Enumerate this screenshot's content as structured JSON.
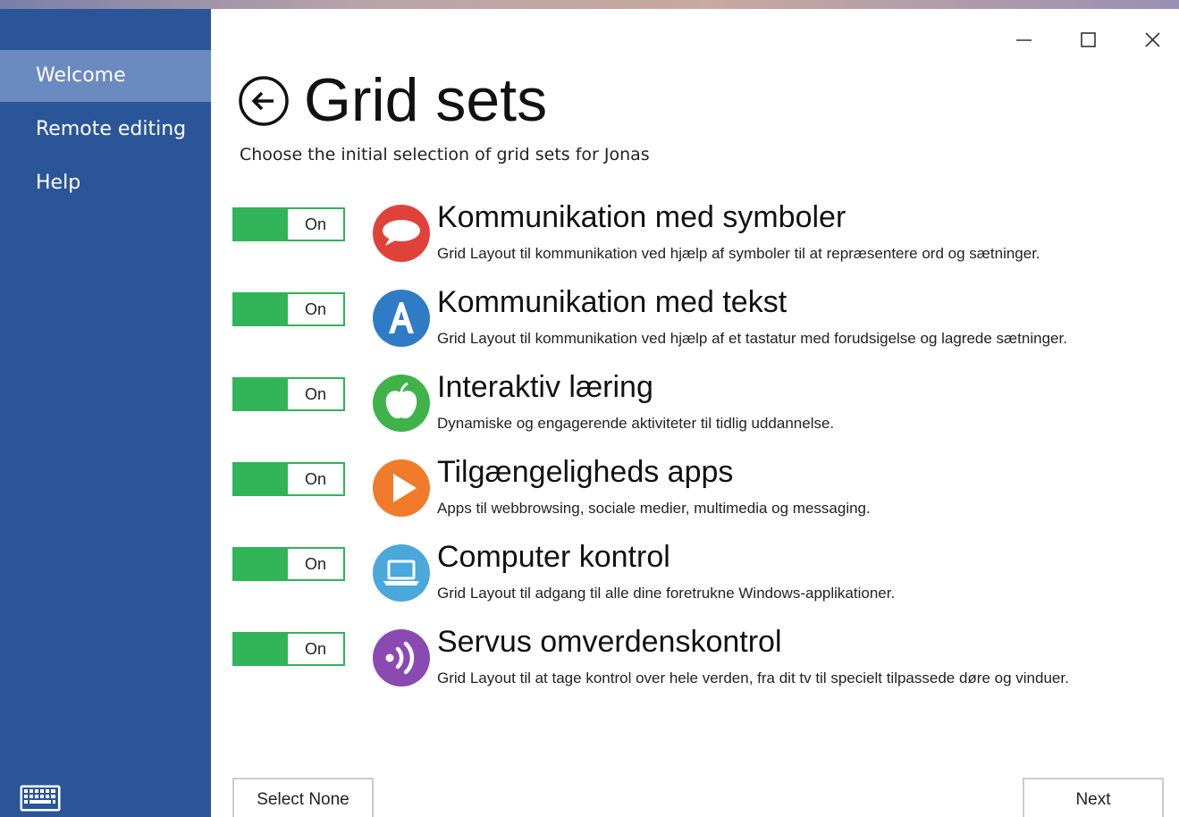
{
  "sidebar": {
    "items": [
      {
        "label": "Welcome",
        "active": true
      },
      {
        "label": "Remote editing",
        "active": false
      },
      {
        "label": "Help",
        "active": false
      }
    ],
    "keyboard_icon": "keyboard-icon"
  },
  "window": {
    "controls": [
      "minimize-icon",
      "maximize-icon",
      "close-icon"
    ]
  },
  "page": {
    "title": "Grid sets",
    "subtitle": "Choose the initial selection of grid sets for Jonas"
  },
  "gridsets": [
    {
      "toggle": "On",
      "title": "Kommunikation med symboler",
      "description": "Grid Layout til kommunikation ved hjælp af symboler til at repræsentere ord og sætninger.",
      "icon": "speech-bubble-icon",
      "color": "#e0423a"
    },
    {
      "toggle": "On",
      "title": "Kommunikation med tekst",
      "description": "Grid Layout til kommunikation ved hjælp af et tastatur med forudsigelse og lagrede sætninger.",
      "icon": "letter-a-icon",
      "color": "#2f7bc6"
    },
    {
      "toggle": "On",
      "title": "Interaktiv læring",
      "description": "Dynamiske og engagerende aktiviteter til tidlig uddannelse.",
      "icon": "apple-icon",
      "color": "#3fb24a"
    },
    {
      "toggle": "On",
      "title": "Tilgængeligheds apps",
      "description": "Apps til webbrowsing, sociale medier, multimedia og messaging.",
      "icon": "play-icon",
      "color": "#f07b2a"
    },
    {
      "toggle": "On",
      "title": "Computer kontrol",
      "description": "Grid Layout til adgang til alle dine foretrukne Windows-applikationer.",
      "icon": "laptop-icon",
      "color": "#4aa8dc"
    },
    {
      "toggle": "On",
      "title": "Servus omverdenskontrol",
      "description": "Grid Layout til at tage kontrol over hele verden, fra dit tv til specielt tilpassede døre og vinduer.",
      "icon": "signal-icon",
      "color": "#8a4ab2"
    }
  ],
  "footer": {
    "select_none": "Select None",
    "next": "Next"
  },
  "colors": {
    "sidebar": "#2a5599",
    "sidebar_active": "#6b8bc0",
    "toggle_on": "#30b457"
  }
}
